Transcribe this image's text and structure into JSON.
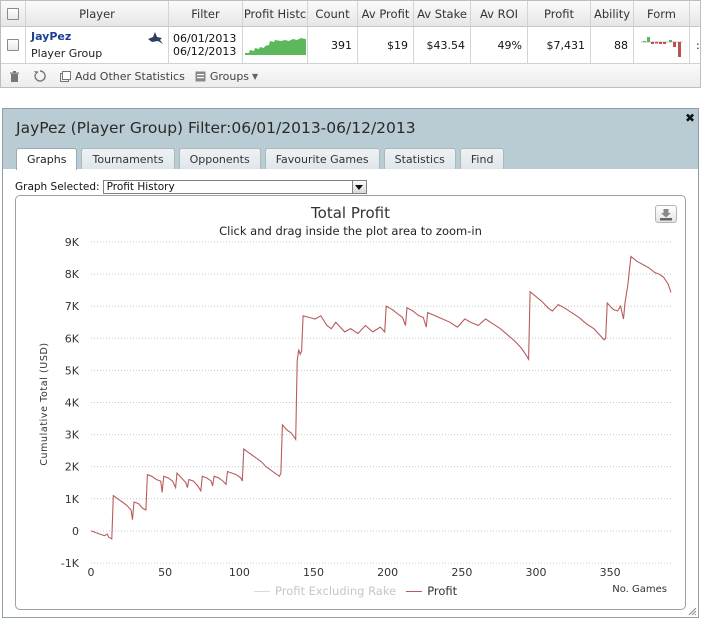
{
  "grid": {
    "columns": [
      "Player",
      "Filter",
      "Profit Histc",
      "Count",
      "Av Profit",
      "Av Stake",
      "Av ROI",
      "Profit",
      "Ability",
      "Form"
    ],
    "row": {
      "player_name": "JayPez",
      "player_group": "Player Group",
      "filter_from": "06/01/2013",
      "filter_to": "06/12/2013",
      "count": "391",
      "av_profit": "$19",
      "av_stake": "$43.54",
      "av_roi": "49%",
      "profit": "$7,431",
      "ability": "88",
      "overflow": ":"
    }
  },
  "toolbar": {
    "add_stats": "Add Other Statistics",
    "groups": "Groups"
  },
  "panel": {
    "title": "JayPez (Player Group) Filter:06/01/2013-06/12/2013",
    "tabs": [
      "Graphs",
      "Tournaments",
      "Opponents",
      "Favourite Games",
      "Statistics",
      "Find"
    ],
    "active_tab": "Graphs",
    "graph_selected_label": "Graph Selected:",
    "graph_selected_value": "Profit History"
  },
  "colors": {
    "profit_line": "#b85c5c",
    "excl_rake_line": "#d9d9d9",
    "panel_header": "#b9cbd3",
    "sparkline": "#5cb85c"
  },
  "chart_data": {
    "type": "line",
    "title": "Total Profit",
    "subtitle": "Click and drag inside the plot area to zoom-in",
    "ylabel": "Cumulative Total (USD)",
    "xlabel": "No. Games",
    "ylim": [
      -1000,
      9000
    ],
    "xlim": [
      0,
      391
    ],
    "yticks": [
      -1000,
      0,
      1000,
      2000,
      3000,
      4000,
      5000,
      6000,
      7000,
      8000,
      9000
    ],
    "ytick_labels": [
      "-1K",
      "0",
      "1K",
      "2K",
      "3K",
      "4K",
      "5K",
      "6K",
      "7K",
      "8K",
      "9K"
    ],
    "xticks": [
      0,
      50,
      100,
      150,
      200,
      250,
      300,
      350
    ],
    "grid": "horizontal-dotted",
    "legend_position": "bottom",
    "series": [
      {
        "name": "Profit Excluding Rake",
        "values": [],
        "hidden": true
      },
      {
        "name": "Profit",
        "points": [
          [
            0,
            0
          ],
          [
            3,
            -50
          ],
          [
            6,
            -100
          ],
          [
            9,
            -150
          ],
          [
            11,
            -100
          ],
          [
            12,
            -200
          ],
          [
            14,
            -250
          ],
          [
            15,
            1100
          ],
          [
            18,
            1000
          ],
          [
            21,
            900
          ],
          [
            24,
            800
          ],
          [
            27,
            650
          ],
          [
            28,
            350
          ],
          [
            29,
            900
          ],
          [
            32,
            850
          ],
          [
            35,
            700
          ],
          [
            37,
            650
          ],
          [
            38,
            1750
          ],
          [
            41,
            1700
          ],
          [
            44,
            1600
          ],
          [
            47,
            1550
          ],
          [
            48,
            1200
          ],
          [
            49,
            1700
          ],
          [
            52,
            1650
          ],
          [
            55,
            1550
          ],
          [
            57,
            1350
          ],
          [
            58,
            1800
          ],
          [
            61,
            1650
          ],
          [
            64,
            1500
          ],
          [
            65,
            1350
          ],
          [
            66,
            1600
          ],
          [
            69,
            1550
          ],
          [
            72,
            1400
          ],
          [
            74,
            1250
          ],
          [
            75,
            1700
          ],
          [
            78,
            1650
          ],
          [
            81,
            1550
          ],
          [
            82,
            1400
          ],
          [
            83,
            1700
          ],
          [
            86,
            1650
          ],
          [
            89,
            1550
          ],
          [
            91,
            1450
          ],
          [
            92,
            1850
          ],
          [
            95,
            1800
          ],
          [
            98,
            1750
          ],
          [
            101,
            1650
          ],
          [
            102,
            1550
          ],
          [
            103,
            2550
          ],
          [
            106,
            2450
          ],
          [
            109,
            2350
          ],
          [
            112,
            2250
          ],
          [
            115,
            2150
          ],
          [
            118,
            2000
          ],
          [
            121,
            1900
          ],
          [
            124,
            1800
          ],
          [
            127,
            1700
          ],
          [
            128,
            1800
          ],
          [
            129,
            3300
          ],
          [
            132,
            3150
          ],
          [
            135,
            3050
          ],
          [
            138,
            2850
          ],
          [
            139,
            5300
          ],
          [
            140,
            5650
          ],
          [
            141,
            5500
          ],
          [
            142,
            5600
          ],
          [
            143,
            6700
          ],
          [
            147,
            6650
          ],
          [
            151,
            6600
          ],
          [
            155,
            6700
          ],
          [
            159,
            6400
          ],
          [
            162,
            6300
          ],
          [
            165,
            6500
          ],
          [
            168,
            6350
          ],
          [
            171,
            6200
          ],
          [
            175,
            6300
          ],
          [
            180,
            6150
          ],
          [
            185,
            6400
          ],
          [
            190,
            6200
          ],
          [
            195,
            6350
          ],
          [
            198,
            6200
          ],
          [
            199,
            7000
          ],
          [
            203,
            6900
          ],
          [
            207,
            6750
          ],
          [
            210,
            6650
          ],
          [
            212,
            6400
          ],
          [
            213,
            6950
          ],
          [
            217,
            6850
          ],
          [
            221,
            6700
          ],
          [
            224,
            6650
          ],
          [
            226,
            6350
          ],
          [
            227,
            6800
          ],
          [
            232,
            6700
          ],
          [
            237,
            6600
          ],
          [
            242,
            6500
          ],
          [
            247,
            6350
          ],
          [
            252,
            6600
          ],
          [
            256,
            6500
          ],
          [
            261,
            6400
          ],
          [
            266,
            6600
          ],
          [
            271,
            6450
          ],
          [
            276,
            6300
          ],
          [
            281,
            6100
          ],
          [
            286,
            5900
          ],
          [
            290,
            5700
          ],
          [
            293,
            5500
          ],
          [
            295,
            5350
          ],
          [
            296,
            7450
          ],
          [
            300,
            7300
          ],
          [
            304,
            7150
          ],
          [
            308,
            6950
          ],
          [
            311,
            6850
          ],
          [
            315,
            7050
          ],
          [
            319,
            6950
          ],
          [
            324,
            6800
          ],
          [
            329,
            6650
          ],
          [
            334,
            6450
          ],
          [
            339,
            6300
          ],
          [
            343,
            6100
          ],
          [
            346,
            5950
          ],
          [
            347,
            6000
          ],
          [
            348,
            7100
          ],
          [
            352,
            6900
          ],
          [
            355,
            6850
          ],
          [
            357,
            7000
          ],
          [
            359,
            6600
          ],
          [
            360,
            7100
          ],
          [
            362,
            7700
          ],
          [
            364,
            8550
          ],
          [
            368,
            8400
          ],
          [
            372,
            8300
          ],
          [
            376,
            8200
          ],
          [
            380,
            8050
          ],
          [
            383,
            8000
          ],
          [
            386,
            7900
          ],
          [
            389,
            7700
          ],
          [
            391,
            7431
          ]
        ]
      }
    ]
  }
}
